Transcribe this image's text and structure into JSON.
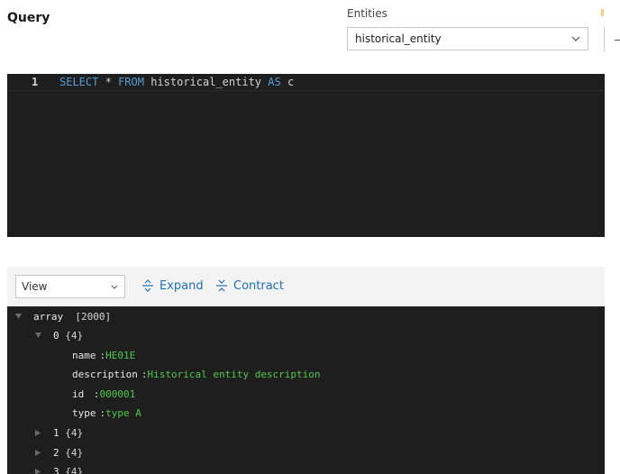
{
  "header": {
    "title": "Query",
    "entities_label": "Entities",
    "entities_value": "historical_entity"
  },
  "editor": {
    "line_number": "1",
    "tokens": {
      "kw_select": "SELECT",
      "star": "*",
      "kw_from": "FROM",
      "table": "historical_entity",
      "kw_as": "AS",
      "alias": "c"
    }
  },
  "toolbar": {
    "view_value": "View",
    "expand_label": "Expand",
    "contract_label": "Contract"
  },
  "tree": {
    "root_label": "array",
    "root_count": "[2000]",
    "items": [
      {
        "index": "0",
        "count": "{4}"
      },
      {
        "index": "1",
        "count": "{4}"
      },
      {
        "index": "2",
        "count": "{4}"
      },
      {
        "index": "3",
        "count": "{4}"
      }
    ],
    "fields": [
      {
        "key": "name",
        "sep": ":",
        "value": "HE01E"
      },
      {
        "key": "description",
        "sep": ":",
        "value": "Historical entity description"
      },
      {
        "key": "id",
        "sep": " :",
        "value": "000001"
      },
      {
        "key": "type",
        "sep": ":",
        "value": "type A"
      }
    ]
  },
  "colors": {
    "keyword": "#569cd6",
    "string_value": "#4ec94e",
    "link": "#1f6fb5",
    "editor_bg": "#1e1e1e"
  }
}
